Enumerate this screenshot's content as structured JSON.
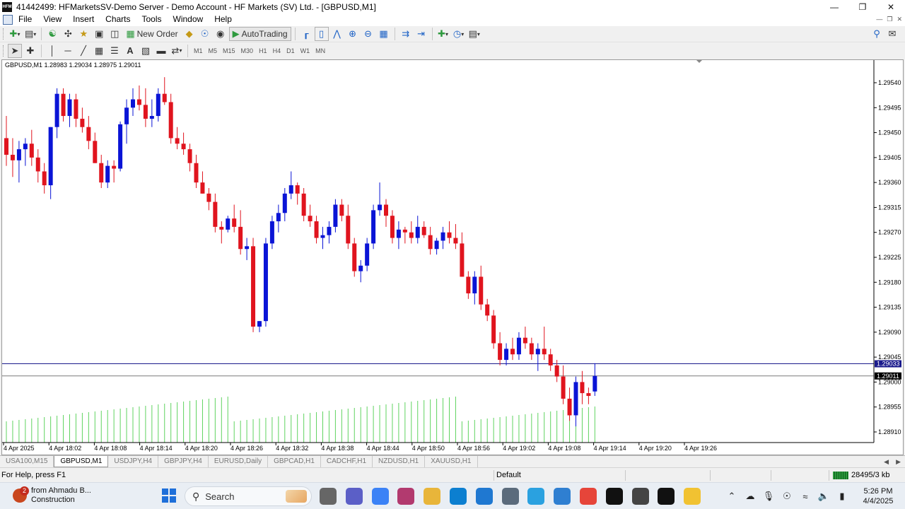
{
  "window": {
    "title": "41442499: HFMarketsSV-Demo Server - Demo Account - HF Markets (SV) Ltd. - [GBPUSD,M1]",
    "app_icon_label": "HFM"
  },
  "menu": [
    "File",
    "View",
    "Insert",
    "Charts",
    "Tools",
    "Window",
    "Help"
  ],
  "toolbar": {
    "new_order": "New Order",
    "auto_trading": "AutoTrading"
  },
  "timeframes": [
    "M1",
    "M5",
    "M15",
    "M30",
    "H1",
    "H4",
    "D1",
    "W1",
    "MN"
  ],
  "chart": {
    "symbol_line": "GBPUSD,M1  1.28983 1.29034 1.28975 1.29011",
    "price_labels": [
      "1.29540",
      "1.29495",
      "1.29450",
      "1.29405",
      "1.29360",
      "1.29315",
      "1.29270",
      "1.29225",
      "1.29180",
      "1.29135",
      "1.29090",
      "1.29045",
      "1.29000",
      "1.28955",
      "1.28910"
    ],
    "time_labels": [
      "4 Apr 2025",
      "4 Apr 18:02",
      "4 Apr 18:08",
      "4 Apr 18:14",
      "4 Apr 18:20",
      "4 Apr 18:26",
      "4 Apr 18:32",
      "4 Apr 18:38",
      "4 Apr 18:44",
      "4 Apr 18:50",
      "4 Apr 18:56",
      "4 Apr 19:02",
      "4 Apr 19:08",
      "4 Apr 19:14",
      "4 Apr 19:20",
      "4 Apr 19:26"
    ],
    "ask_price": "1.29033",
    "bid_price": "1.29011",
    "colors": {
      "bull": "#0a14d6",
      "bear": "#e0141e",
      "volume": "#5fd35f",
      "ask_line": "#1a1a8c",
      "bid_line": "#7a7a7a",
      "ask_label_bg": "#1a1a8c",
      "bid_label_bg": "#000000"
    }
  },
  "tabs": [
    "USA100,M15",
    "GBPUSD,M1",
    "USDJPY,H4",
    "GBPJPY,H4",
    "EURUSD,Daily",
    "GBPCAD,H1",
    "CADCHF,H1",
    "NZDUSD,H1",
    "XAUUSD,H1"
  ],
  "active_tab": 1,
  "status": {
    "help": "For Help, press F1",
    "profile": "Default",
    "traffic": "28495/3 kb"
  },
  "taskbar": {
    "notification_count": "2",
    "weather_line1": "from Ahmadu B...",
    "weather_line2": "Construction",
    "search_placeholder": "Search",
    "apps": [
      {
        "name": "task-view",
        "color": "#666"
      },
      {
        "name": "teams",
        "color": "#5b5fc7"
      },
      {
        "name": "copilot",
        "color": "#3b82f6"
      },
      {
        "name": "snipping",
        "color": "#b23a6f"
      },
      {
        "name": "explorer",
        "color": "#e8b53a"
      },
      {
        "name": "edge",
        "color": "#0c7fd0"
      },
      {
        "name": "store",
        "color": "#1f78d1"
      },
      {
        "name": "calculator",
        "color": "#5b6b7c"
      },
      {
        "name": "telegram",
        "color": "#2aa1e0"
      },
      {
        "name": "notepad",
        "color": "#2f7fd1"
      },
      {
        "name": "chrome",
        "color": "#e6453a"
      },
      {
        "name": "tradingview",
        "color": "#111111"
      },
      {
        "name": "obs",
        "color": "#444444"
      },
      {
        "name": "hfm",
        "color": "#111111"
      },
      {
        "name": "drive",
        "color": "#f1c232"
      }
    ],
    "time": "5:26 PM",
    "date": "4/4/2025"
  }
}
